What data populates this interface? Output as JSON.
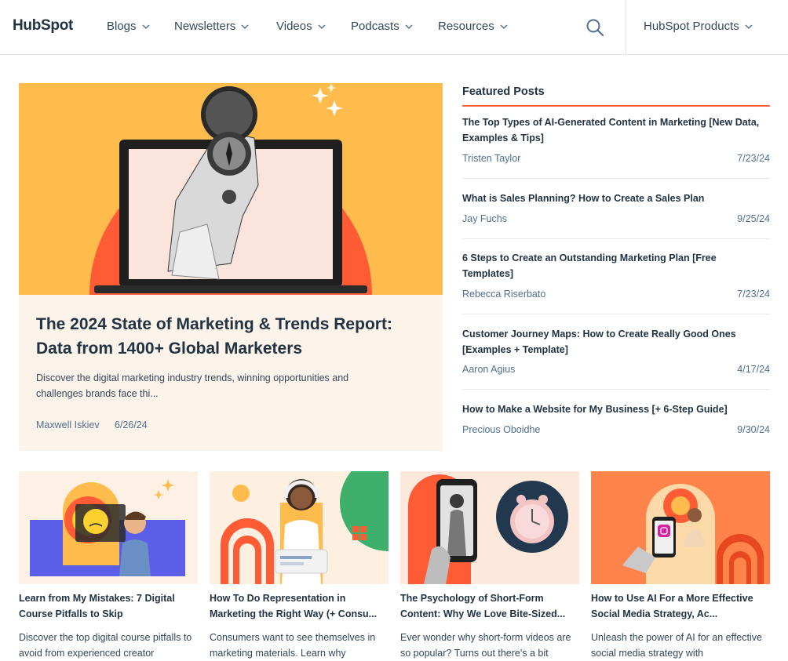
{
  "header": {
    "logo_text": "HubSpot",
    "nav": [
      {
        "label": "Blogs"
      },
      {
        "label": "Newsletters"
      },
      {
        "label": "Videos"
      },
      {
        "label": "Podcasts"
      },
      {
        "label": "Resources"
      }
    ],
    "search_icon": "search-icon",
    "products_label": "HubSpot Products"
  },
  "hero": {
    "title": "The 2024 State of Marketing & Trends Report: Data from 1400+ Global Marketers",
    "description": "Discover the digital marketing industry trends, winning opportunities and challenges brands face thi...",
    "author": "Maxwell Iskiev",
    "date": "6/26/24"
  },
  "featured": {
    "heading": "Featured Posts",
    "posts": [
      {
        "title": "The Top Types of AI-Generated Content in Marketing [New Data, Examples & Tips]",
        "author": "Tristen Taylor",
        "date": "7/23/24"
      },
      {
        "title": "What is Sales Planning? How to Create a Sales Plan",
        "author": "Jay Fuchs",
        "date": "9/25/24"
      },
      {
        "title": "6 Steps to Create an Outstanding Marketing Plan [Free Templates]",
        "author": "Rebecca Riserbato",
        "date": "7/23/24"
      },
      {
        "title": "Customer Journey Maps: How to Create Really Good Ones [Examples + Template]",
        "author": "Aaron Agius",
        "date": "4/17/24"
      },
      {
        "title": "How to Make a Website for My Business [+ 6-Step Guide]",
        "author": "Precious Oboidhe",
        "date": "9/30/24"
      }
    ]
  },
  "cards": [
    {
      "title": "Learn from My Mistakes: 7 Digital Course Pitfalls to Skip",
      "description": "Discover the top digital course pitfalls to avoid from experienced creator"
    },
    {
      "title": "How To Do Representation in Marketing the Right Way (+ Consu...",
      "description": "Consumers want to see themselves in marketing materials. Learn why"
    },
    {
      "title": "The Psychology of Short-Form Content: Why We Love Bite-Sized...",
      "description": "Ever wonder why short-form videos are so popular? Turns out there's a bit"
    },
    {
      "title": "How to Use AI For a More Effective Social Media Strategy, Ac...",
      "description": "Unleash the power of AI for an effective social media strategy with"
    }
  ],
  "colors": {
    "accent": "#ff5c35",
    "text": "#213343",
    "muted": "#516f90",
    "hero_bg": "#fcf3ea"
  }
}
